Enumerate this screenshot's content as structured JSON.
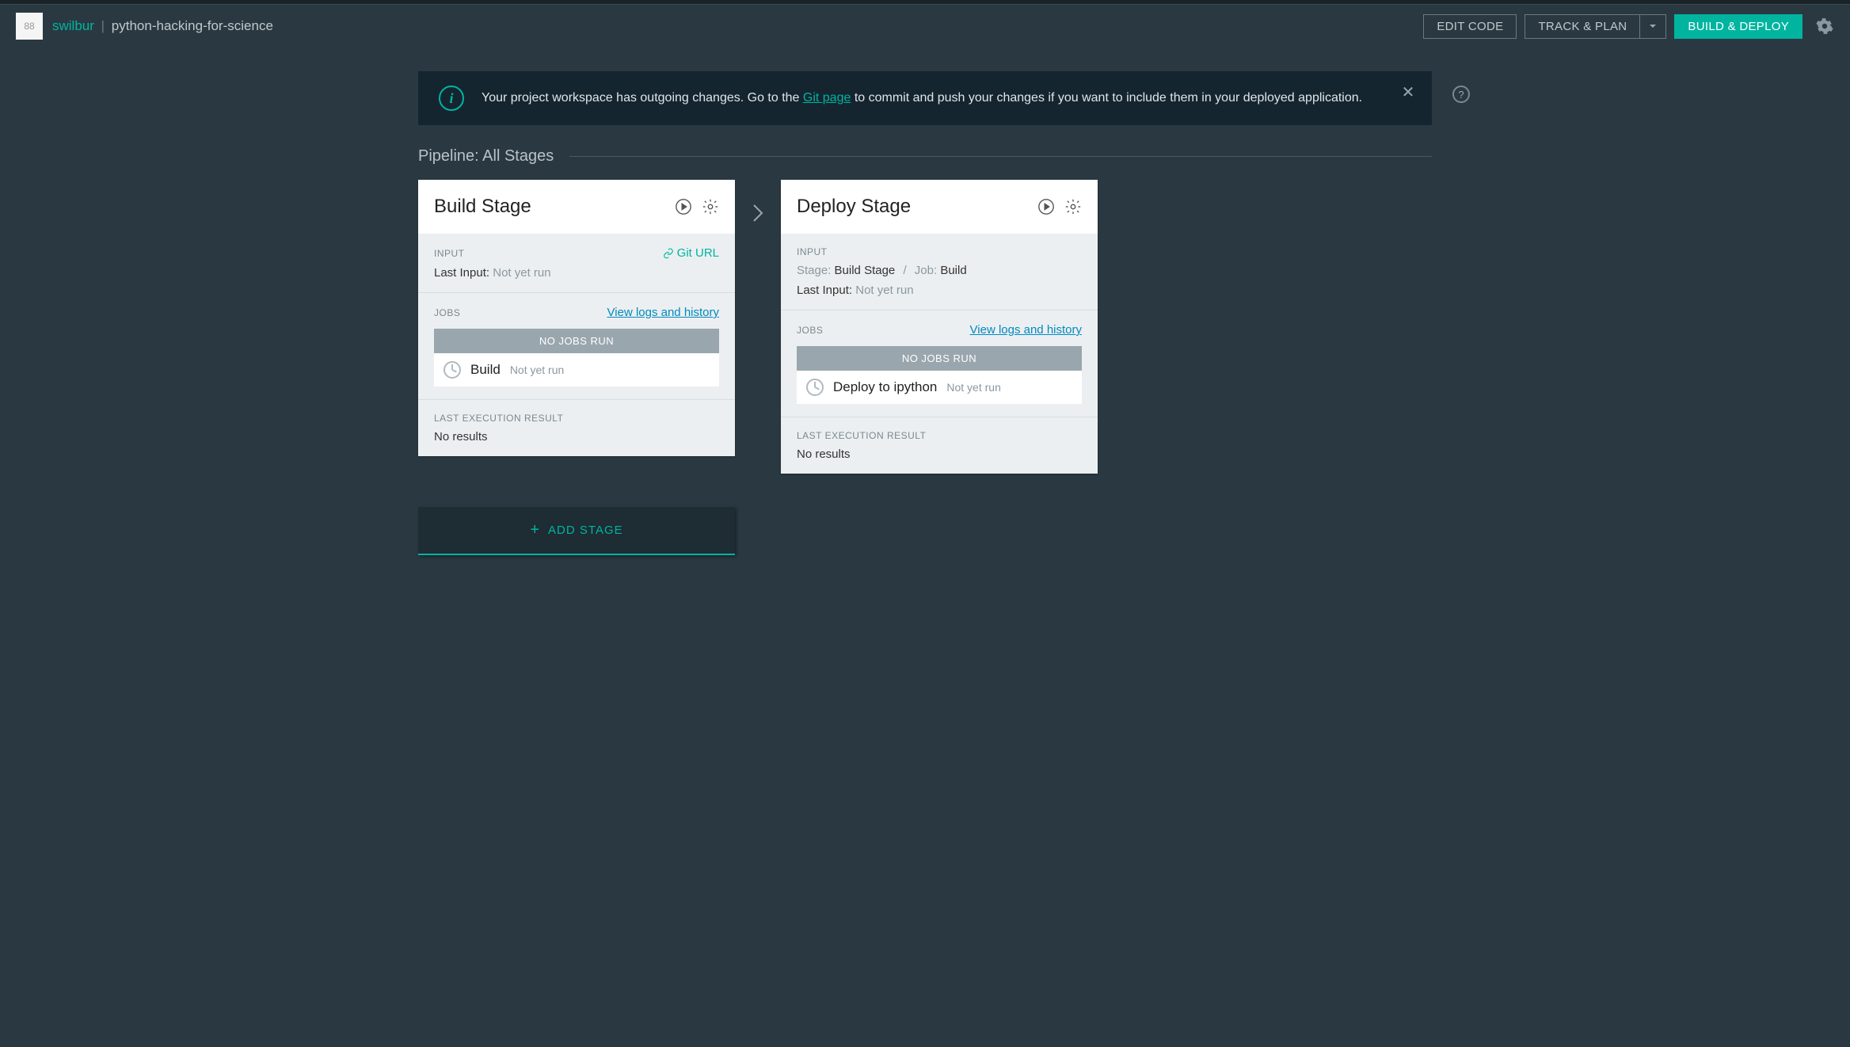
{
  "header": {
    "app_icon_text": "88",
    "user": "swilbur",
    "sep": "|",
    "project": "python-hacking-for-science",
    "edit_code": "EDIT CODE",
    "track_plan": "TRACK & PLAN",
    "build_deploy": "BUILD & DEPLOY"
  },
  "notice": {
    "pre": "Your project workspace has outgoing changes. Go to the ",
    "link": "Git page",
    "post": " to commit and push your changes if you want to include them in your deployed application."
  },
  "pipeline_title": "Pipeline: All Stages",
  "stages": [
    {
      "title": "Build Stage",
      "input_label": "INPUT",
      "input_badge": "Git URL",
      "input_detail_prefix": "Last Input:",
      "input_detail_value": "Not yet run",
      "jobs_label": "JOBS",
      "view_logs": "View logs and history",
      "no_jobs": "NO JOBS RUN",
      "job_name": "Build",
      "job_status": "Not yet run",
      "last_exec_label": "LAST EXECUTION RESULT",
      "last_exec_value": "No results"
    },
    {
      "title": "Deploy Stage",
      "input_label": "INPUT",
      "input_stage_prefix": "Stage:",
      "input_stage_value": "Build Stage",
      "input_sep": "/",
      "input_job_prefix": "Job:",
      "input_job_value": "Build",
      "input_detail_prefix": "Last Input:",
      "input_detail_value": "Not yet run",
      "jobs_label": "JOBS",
      "view_logs": "View logs and history",
      "no_jobs": "NO JOBS RUN",
      "job_name": "Deploy to ipython",
      "job_status": "Not yet run",
      "last_exec_label": "LAST EXECUTION RESULT",
      "last_exec_value": "No results"
    }
  ],
  "add_stage": "ADD STAGE"
}
